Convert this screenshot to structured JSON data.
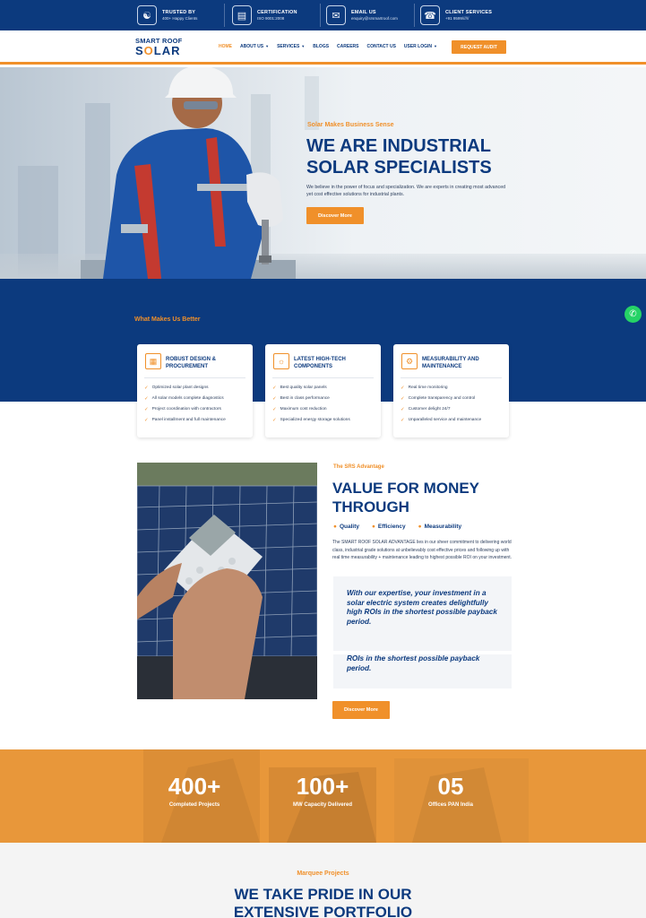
{
  "topbar": {
    "items": [
      {
        "title": "TRUSTED BY",
        "sub": "400+ Happy Clients",
        "icon": "handshake-icon"
      },
      {
        "title": "CERTIFICATION",
        "sub": "ISO 9001:2008",
        "icon": "certificate-icon"
      },
      {
        "title": "EMAIL US",
        "sub": "enquiry@srsmartroof.com",
        "icon": "envelope-icon"
      },
      {
        "title": "CLIENT SERVICES",
        "sub": "+91 9599&#x2F;&#x2F;&#x2F;",
        "icon": "headset-icon"
      }
    ]
  },
  "brand": {
    "top": "SMART ROOF",
    "bottom_left": "S",
    "bottom_sun": "O",
    "bottom_right": "LAR",
    "accent": "#f0902a",
    "primary": "#0c3a7e"
  },
  "nav": {
    "links": [
      {
        "label": "HOME",
        "dropdown": false
      },
      {
        "label": "ABOUT US",
        "dropdown": true
      },
      {
        "label": "SERVICES",
        "dropdown": true
      },
      {
        "label": "BLOGS",
        "dropdown": false
      },
      {
        "label": "CAREERS",
        "dropdown": false
      },
      {
        "label": "CONTACT US",
        "dropdown": false
      },
      {
        "label": "USER LOGIN",
        "dropdown": true
      }
    ],
    "cta": "REQUEST AUDIT"
  },
  "hero": {
    "subtitle": "Solar Makes Business Sense",
    "title": "WE ARE INDUSTRIAL SOLAR SPECIALISTS",
    "description": "We believe in the power of focus and specialization. We are experts in creating most advanced yet cost effective solutions for industrial plants.",
    "button": "Discover More"
  },
  "why": {
    "title": "What Makes Us Better",
    "cards": [
      {
        "title": "ROBUST DESIGN & PROCUREMENT",
        "icon": "solar-panel-icon",
        "items": [
          "Optimized solar plant designs",
          "All solar models complete diagnostics",
          "Project coordination with contractors",
          "Panel installment and full maintenance"
        ]
      },
      {
        "title": "LATEST HIGH-TECH COMPONENTS",
        "icon": "sun-panel-icon",
        "items": [
          "Best quality solar panels",
          "Best in class performance",
          "Maximum cost reduction",
          "Specialized energy storage solutions"
        ]
      },
      {
        "title": "MEASURABILITY AND MAINTENANCE",
        "icon": "monitoring-icon",
        "items": [
          "Real time monitoring",
          "Complete transparency and control",
          "Customer delight 24/7",
          "Unparalleled service and maintenance"
        ]
      }
    ]
  },
  "srs": {
    "subtitle": "The SRS Advantage",
    "title": "VALUE FOR MONEY THROUGH",
    "tags": [
      "Quality",
      "Efficiency",
      "Measurability"
    ],
    "body": "The SMART ROOF SOLAR ADVANTAGE lies in our sheer commitment to delivering world class, industrial grade solutions at unbelievably cost effective prices and following up with real time measurability + maintenance leading to highest possible ROI on your investment.",
    "quote": "With our expertise, your investment in a solar electric system creates delightfully high ROIs in the shortest possible payback period.",
    "quote_repeat": "ROIs in the shortest possible payback period.",
    "button": "Discover More"
  },
  "stats": [
    {
      "value": "400+",
      "label": "Completed Projects"
    },
    {
      "value": "100+",
      "label": "MW Capacity Delivered"
    },
    {
      "value": "05",
      "label": "Offices PAN India"
    }
  ],
  "marquee": {
    "subtitle": "Marquee Projects",
    "title": "WE TAKE PRIDE IN OUR EXTENSIVE PORTFOLIO"
  },
  "whatsapp": {
    "icon": "whatsapp-icon"
  }
}
